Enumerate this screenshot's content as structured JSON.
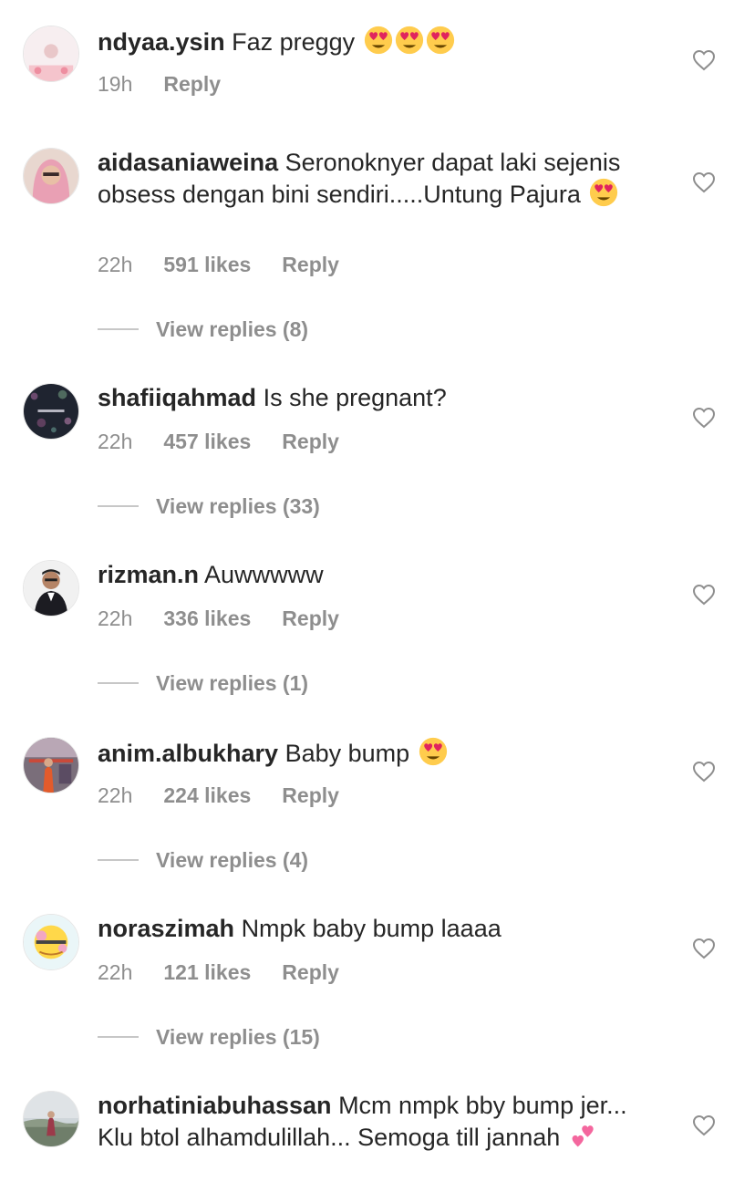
{
  "comments": [
    {
      "username": "ndyaa.ysin",
      "text": "Faz preggy",
      "emojis": [
        "heart-eyes",
        "heart-eyes",
        "heart-eyes"
      ],
      "time": "19h",
      "likes": "",
      "reply": "Reply",
      "view_replies": ""
    },
    {
      "username": "aidasaniaweina",
      "text": "Seronoknyer dapat laki sejenis obsess dengan bini sendiri.....Untung Pajura",
      "emojis": [
        "heart-eyes"
      ],
      "time": "22h",
      "likes": "591 likes",
      "reply": "Reply",
      "view_replies": "View replies (8)"
    },
    {
      "username": "shafiiqahmad",
      "text": "Is she pregnant?",
      "emojis": [],
      "time": "22h",
      "likes": "457 likes",
      "reply": "Reply",
      "view_replies": "View replies (33)"
    },
    {
      "username": "rizman.n",
      "text": "Auwwwww",
      "emojis": [],
      "time": "22h",
      "likes": "336 likes",
      "reply": "Reply",
      "view_replies": "View replies (1)"
    },
    {
      "username": "anim.albukhary",
      "text": "Baby bump",
      "emojis": [
        "heart-eyes"
      ],
      "time": "22h",
      "likes": "224 likes",
      "reply": "Reply",
      "view_replies": "View replies (4)"
    },
    {
      "username": "noraszimah",
      "text": "Nmpk baby bump laaaa",
      "emojis": [],
      "time": "22h",
      "likes": "121 likes",
      "reply": "Reply",
      "view_replies": "View replies (15)"
    },
    {
      "username": "norhatiniabuhassan",
      "text": "Mcm nmpk bby bump jer... Klu btol alhamdulillah... Semoga till jannah",
      "emojis": [
        "two-hearts"
      ],
      "time": "",
      "likes": "",
      "reply": "",
      "view_replies": ""
    }
  ],
  "icons": {
    "like": "heart-outline-icon",
    "heart_eyes": "heart-eyes-emoji",
    "two_hearts": "two-hearts-emoji"
  },
  "colors": {
    "text": "#262626",
    "muted": "#8e8e8e",
    "divider": "#c7c7c7",
    "emoji_face": "#ffcc4d",
    "emoji_heart": "#e0245e",
    "two_hearts": "#f4679e"
  }
}
